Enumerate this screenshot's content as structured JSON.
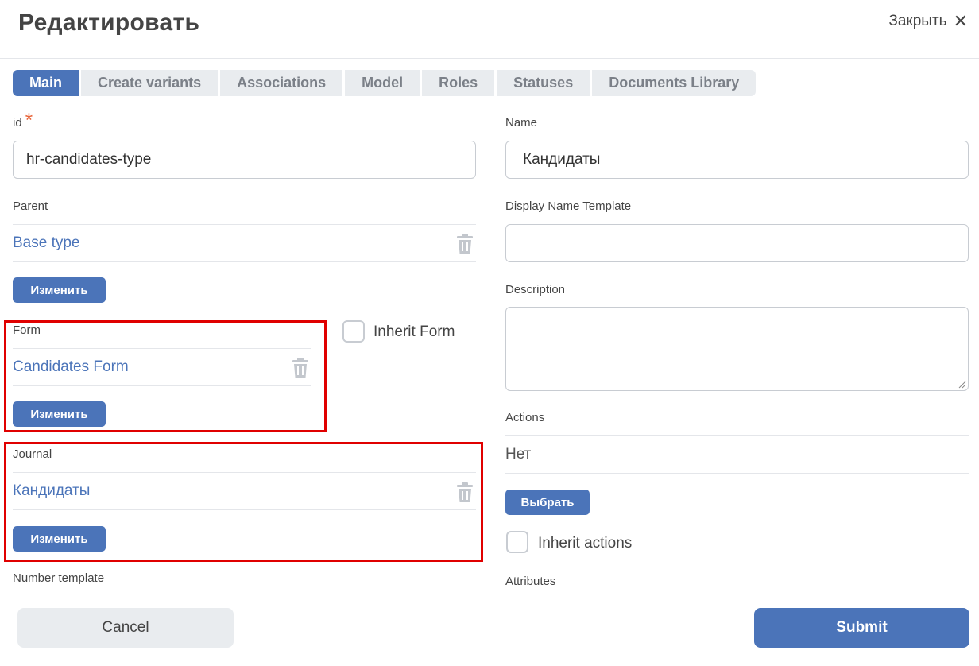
{
  "header": {
    "title": "Редактировать",
    "close_label": "Закрыть"
  },
  "tabs": [
    {
      "label": "Main",
      "active": true
    },
    {
      "label": "Create variants"
    },
    {
      "label": "Associations"
    },
    {
      "label": "Model"
    },
    {
      "label": "Roles"
    },
    {
      "label": "Statuses"
    },
    {
      "label": "Documents Library"
    }
  ],
  "left": {
    "id": {
      "label": "id",
      "required_mark": "*",
      "value": "hr-candidates-type"
    },
    "parent": {
      "label": "Parent",
      "value": "Base type",
      "button": "Изменить"
    },
    "form": {
      "label": "Form",
      "value": "Candidates Form",
      "button": "Изменить"
    },
    "inherit_form": {
      "label": "Inherit Form",
      "checked": false
    },
    "journal": {
      "label": "Journal",
      "value": "Кандидаты",
      "button": "Изменить"
    },
    "number_template": {
      "label": "Number template"
    }
  },
  "right": {
    "name": {
      "label": "Name",
      "value": "Кандидаты"
    },
    "display_name_template": {
      "label": "Display Name Template",
      "value": ""
    },
    "description": {
      "label": "Description",
      "value": ""
    },
    "actions": {
      "label": "Actions",
      "value": "Нет",
      "button": "Выбрать"
    },
    "inherit_actions": {
      "label": "Inherit actions",
      "checked": false
    },
    "attributes": {
      "label": "Attributes"
    }
  },
  "footer": {
    "cancel": "Cancel",
    "submit": "Submit"
  },
  "colors": {
    "accent": "#4b74b9",
    "highlight": "#e00000",
    "required": "#e8653a"
  }
}
